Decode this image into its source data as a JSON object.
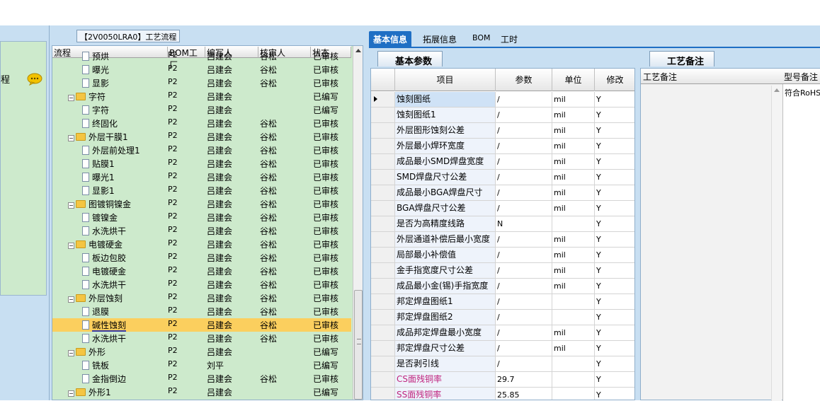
{
  "left_panel": {
    "label": "程"
  },
  "tree": {
    "title": "【2V0050LRA0】工艺流程",
    "columns": [
      "流程",
      "BOM工厂",
      "编写人",
      "核审人",
      "状态"
    ],
    "rows": [
      {
        "indent": 2,
        "type": "doc",
        "name": "预烘",
        "bom": "P2",
        "writer": "吕建会",
        "checker": "谷松",
        "status": "已审核"
      },
      {
        "indent": 2,
        "type": "doc",
        "name": "曝光",
        "bom": "P2",
        "writer": "吕建会",
        "checker": "谷松",
        "status": "已审核"
      },
      {
        "indent": 2,
        "type": "doc",
        "name": "显影",
        "bom": "P2",
        "writer": "吕建会",
        "checker": "谷松",
        "status": "已审核"
      },
      {
        "indent": 1,
        "type": "folder",
        "name": "字符",
        "bom": "P2",
        "writer": "吕建会",
        "checker": "",
        "status": "已编写"
      },
      {
        "indent": 2,
        "type": "doc",
        "name": "字符",
        "bom": "P2",
        "writer": "吕建会",
        "checker": "",
        "status": "已编写"
      },
      {
        "indent": 2,
        "type": "doc",
        "name": "终固化",
        "bom": "P2",
        "writer": "吕建会",
        "checker": "谷松",
        "status": "已审核"
      },
      {
        "indent": 1,
        "type": "folder",
        "name": "外层干膜1",
        "bom": "P2",
        "writer": "吕建会",
        "checker": "谷松",
        "status": "已审核"
      },
      {
        "indent": 2,
        "type": "doc",
        "name": "外层前处理1",
        "bom": "P2",
        "writer": "吕建会",
        "checker": "谷松",
        "status": "已审核"
      },
      {
        "indent": 2,
        "type": "doc",
        "name": "贴膜1",
        "bom": "P2",
        "writer": "吕建会",
        "checker": "谷松",
        "status": "已审核"
      },
      {
        "indent": 2,
        "type": "doc",
        "name": "曝光1",
        "bom": "P2",
        "writer": "吕建会",
        "checker": "谷松",
        "status": "已审核"
      },
      {
        "indent": 2,
        "type": "doc",
        "name": "显影1",
        "bom": "P2",
        "writer": "吕建会",
        "checker": "谷松",
        "status": "已审核"
      },
      {
        "indent": 1,
        "type": "folder",
        "name": "图镀铜镍金",
        "bom": "P2",
        "writer": "吕建会",
        "checker": "谷松",
        "status": "已审核"
      },
      {
        "indent": 2,
        "type": "doc",
        "name": "镀镍金",
        "bom": "P2",
        "writer": "吕建会",
        "checker": "谷松",
        "status": "已审核"
      },
      {
        "indent": 2,
        "type": "doc",
        "name": "水洗烘干",
        "bom": "P2",
        "writer": "吕建会",
        "checker": "谷松",
        "status": "已审核"
      },
      {
        "indent": 1,
        "type": "folder",
        "name": "电镀硬金",
        "bom": "P2",
        "writer": "吕建会",
        "checker": "谷松",
        "status": "已审核"
      },
      {
        "indent": 2,
        "type": "doc",
        "name": "板边包胶",
        "bom": "P2",
        "writer": "吕建会",
        "checker": "谷松",
        "status": "已审核"
      },
      {
        "indent": 2,
        "type": "doc",
        "name": "电镀硬金",
        "bom": "P2",
        "writer": "吕建会",
        "checker": "谷松",
        "status": "已审核"
      },
      {
        "indent": 2,
        "type": "doc",
        "name": "水洗烘干",
        "bom": "P2",
        "writer": "吕建会",
        "checker": "谷松",
        "status": "已审核"
      },
      {
        "indent": 1,
        "type": "folder",
        "name": "外层蚀刻",
        "bom": "P2",
        "writer": "吕建会",
        "checker": "谷松",
        "status": "已审核"
      },
      {
        "indent": 2,
        "type": "doc",
        "name": "退膜",
        "bom": "P2",
        "writer": "吕建会",
        "checker": "谷松",
        "status": "已审核"
      },
      {
        "indent": 2,
        "type": "doc",
        "name": "碱性蚀刻",
        "bom": "P2",
        "writer": "吕建会",
        "checker": "谷松",
        "status": "已审核",
        "selected": true
      },
      {
        "indent": 2,
        "type": "doc",
        "name": "水洗烘干",
        "bom": "P2",
        "writer": "吕建会",
        "checker": "谷松",
        "status": "已审核"
      },
      {
        "indent": 1,
        "type": "folder",
        "name": "外形",
        "bom": "P2",
        "writer": "吕建会",
        "checker": "",
        "status": "已编写"
      },
      {
        "indent": 2,
        "type": "doc",
        "name": "铣板",
        "bom": "P2",
        "writer": "刘平",
        "checker": "",
        "status": "已编写"
      },
      {
        "indent": 2,
        "type": "doc",
        "name": "金指倒边",
        "bom": "P2",
        "writer": "吕建会",
        "checker": "谷松",
        "status": "已审核"
      },
      {
        "indent": 1,
        "type": "folder",
        "name": "外形1",
        "bom": "P2",
        "writer": "吕建会",
        "checker": "",
        "status": "已编写"
      }
    ]
  },
  "tabs": [
    "基本信息",
    "拓展信息",
    "BOM",
    "工时"
  ],
  "basic_params": {
    "title": "基本参数",
    "columns": [
      "项目",
      "参数",
      "单位",
      "修改"
    ],
    "rows": [
      {
        "item": "蚀刻图纸",
        "param": "/",
        "unit": "mil",
        "mod": "Y",
        "current": true
      },
      {
        "item": "蚀刻图纸1",
        "param": "/",
        "unit": "mil",
        "mod": "Y"
      },
      {
        "item": "外层图形蚀刻公差",
        "param": "/",
        "unit": "mil",
        "mod": "Y"
      },
      {
        "item": "外层最小焊环宽度",
        "param": "/",
        "unit": "mil",
        "mod": "Y"
      },
      {
        "item": "成品最小SMD焊盘宽度",
        "param": "/",
        "unit": "mil",
        "mod": "Y"
      },
      {
        "item": "SMD焊盘尺寸公差",
        "param": "/",
        "unit": "mil",
        "mod": "Y"
      },
      {
        "item": "成品最小BGA焊盘尺寸",
        "param": "/",
        "unit": "mil",
        "mod": "Y"
      },
      {
        "item": "BGA焊盘尺寸公差",
        "param": "/",
        "unit": "mil",
        "mod": "Y"
      },
      {
        "item": "是否为高精度线路",
        "param": "N",
        "unit": "",
        "mod": "Y"
      },
      {
        "item": "外层通道补偿后最小宽度",
        "param": "/",
        "unit": "mil",
        "mod": "Y"
      },
      {
        "item": "局部最小补偿值",
        "param": "/",
        "unit": "mil",
        "mod": "Y"
      },
      {
        "item": "金手指宽度尺寸公差",
        "param": "/",
        "unit": "mil",
        "mod": "Y"
      },
      {
        "item": "成品最小金(锡)手指宽度",
        "param": "/",
        "unit": "mil",
        "mod": "Y"
      },
      {
        "item": "邦定焊盘图纸1",
        "param": "/",
        "unit": "",
        "mod": "Y"
      },
      {
        "item": "邦定焊盘图纸2",
        "param": "/",
        "unit": "",
        "mod": "Y"
      },
      {
        "item": "成品邦定焊盘最小宽度",
        "param": "/",
        "unit": "mil",
        "mod": "Y"
      },
      {
        "item": "邦定焊盘尺寸公差",
        "param": "/",
        "unit": "mil",
        "mod": "Y"
      },
      {
        "item": "是否剥引线",
        "param": "/",
        "unit": "",
        "mod": "Y"
      },
      {
        "item": "CS面残铜率",
        "param": "29.7",
        "unit": "",
        "mod": "Y",
        "pink": true
      },
      {
        "item": "SS面残铜率",
        "param": "25.85",
        "unit": "",
        "mod": "Y",
        "pink": true
      }
    ]
  },
  "process_notes": {
    "title": "工艺备注",
    "col1": "工艺备注",
    "col2": "型号备注",
    "col2_value": "符合RoHS"
  },
  "colors": {
    "accent": "#1f6fc4",
    "tree_bg": "#cdeacc",
    "selected": "#fbcf5e",
    "pink_text": "#c0257f",
    "frame": "#c8dff2"
  }
}
